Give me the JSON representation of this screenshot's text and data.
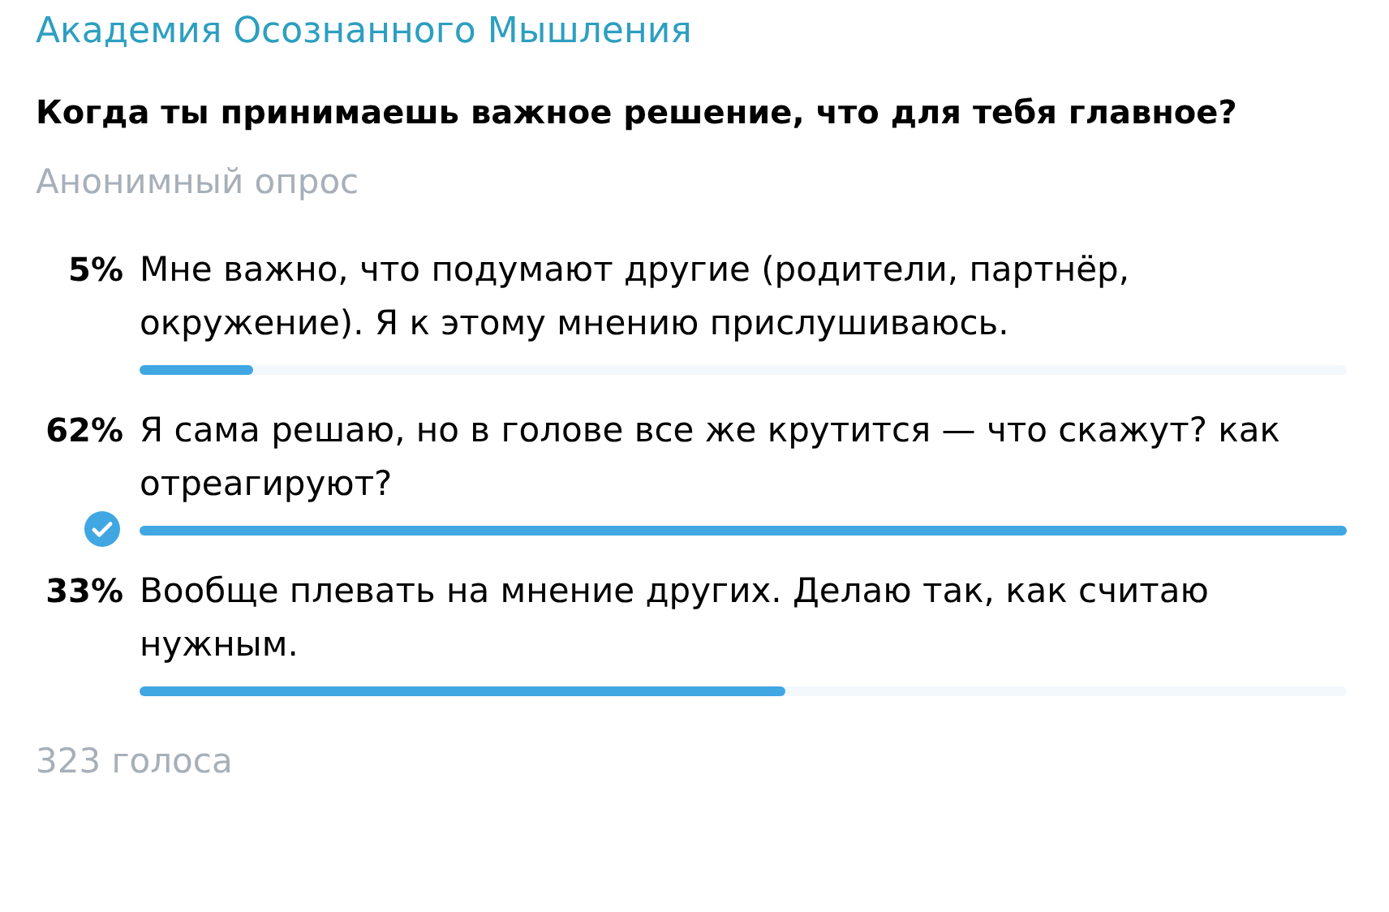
{
  "channel": {
    "name": "Академия Осознанного Мышления"
  },
  "poll": {
    "question": "Когда ты принимаешь важное решение, что для тебя главное?",
    "type_label": "Анонимный опрос",
    "options": [
      {
        "percent": "5%",
        "text": "Мне важно, что подумают другие (родители, партнёр, окружение). Я к этому мнению прислушиваюсь.",
        "level": 0.094,
        "selected": false
      },
      {
        "percent": "62%",
        "text": "Я сама решаю, но в голове все же крутится — что скажут? как  отреагируют?",
        "level": 1,
        "selected": true
      },
      {
        "percent": "33%",
        "text": "Вообще плевать на мнение других. Делаю так, как считаю нужным.",
        "level": 0.535,
        "selected": false
      }
    ],
    "votes": "323 голоса"
  }
}
